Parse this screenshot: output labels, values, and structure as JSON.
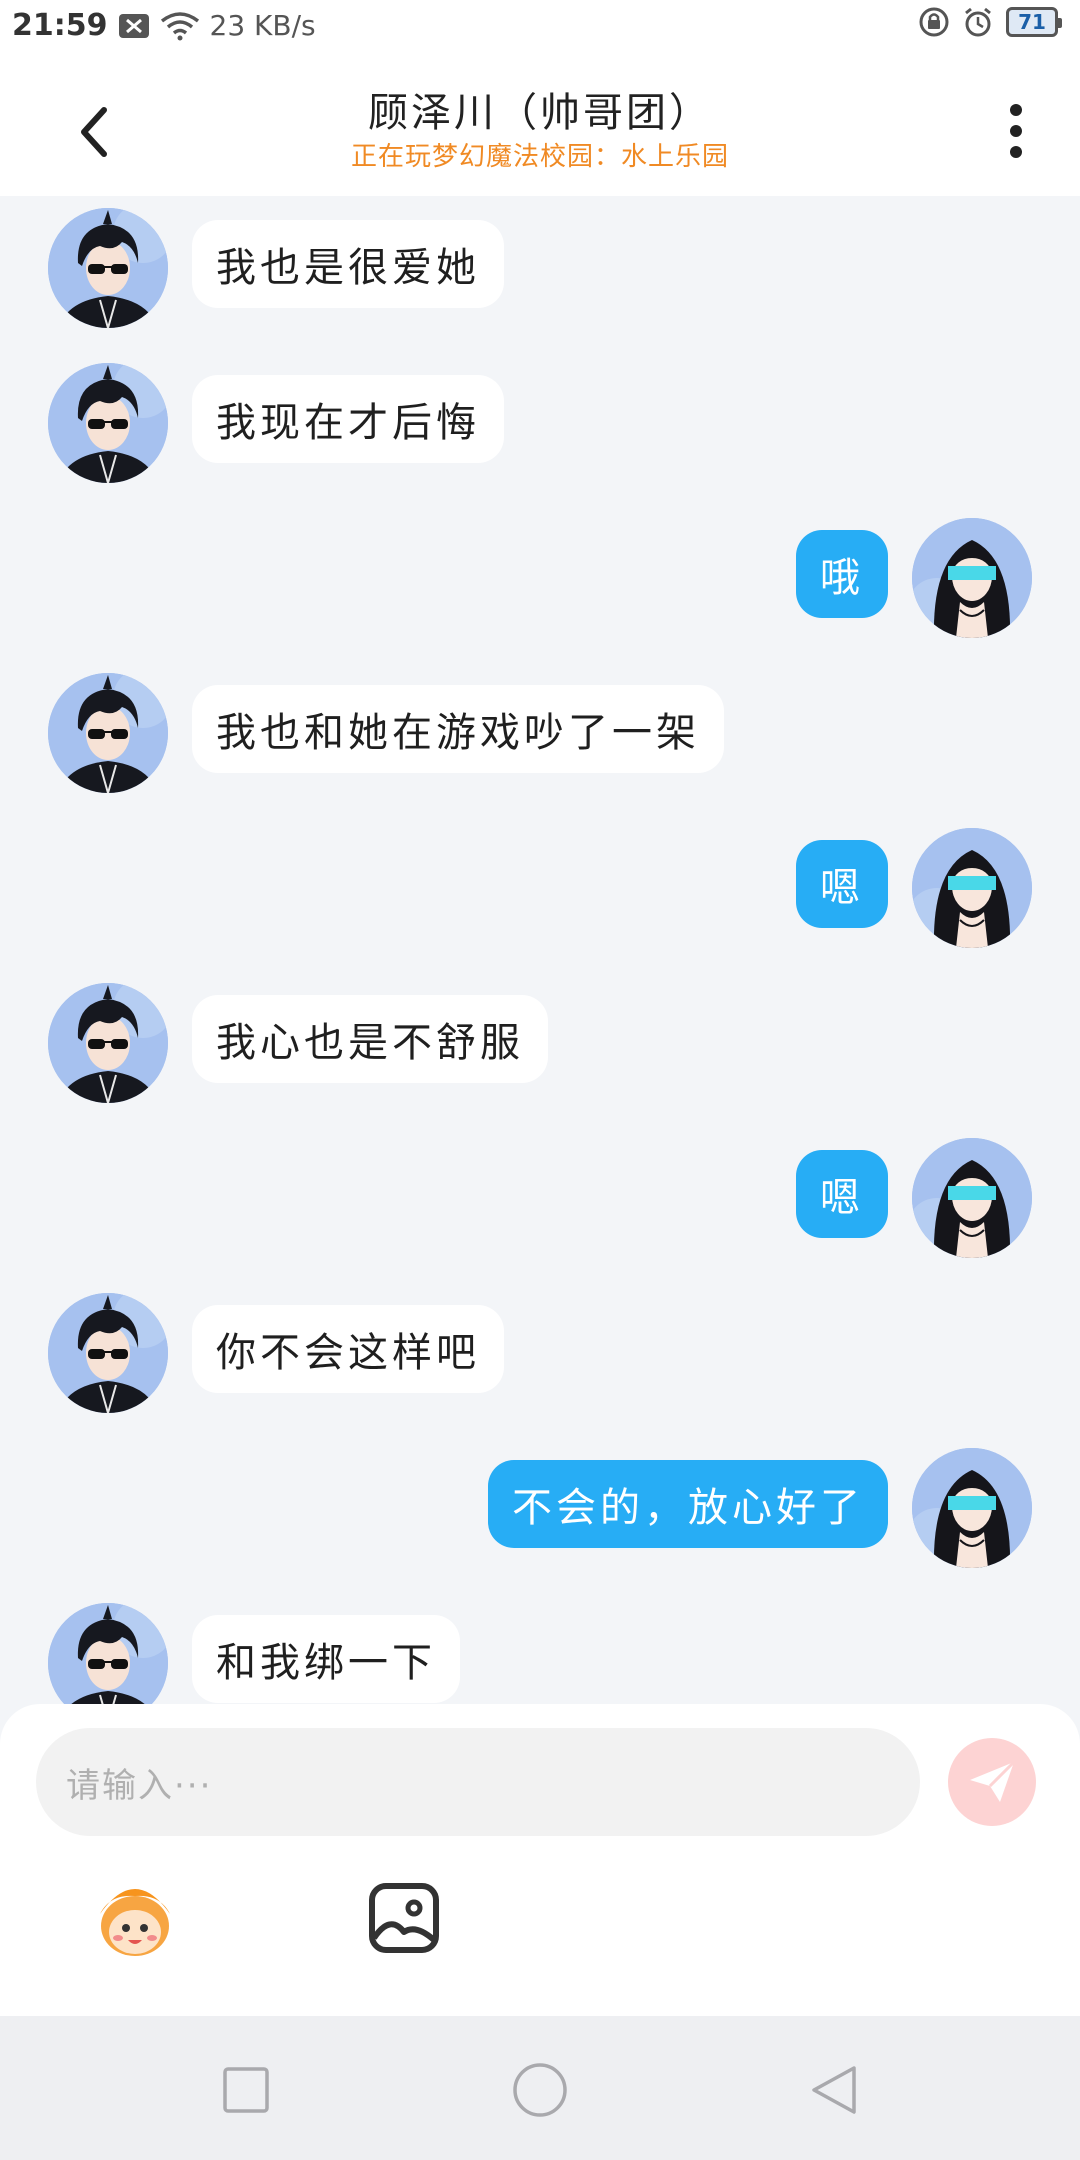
{
  "status_bar": {
    "time": "21:59",
    "net_speed": "23 KB/s",
    "battery": "71"
  },
  "header": {
    "title": "顾泽川（帅哥团）",
    "subtitle": "正在玩梦幻魔法校园：水上乐园"
  },
  "messages": [
    {
      "side": "in",
      "text": "我也是很爱她"
    },
    {
      "side": "in",
      "text": "我现在才后悔"
    },
    {
      "side": "out",
      "text": "哦"
    },
    {
      "side": "in",
      "text": "我也和她在游戏吵了一架"
    },
    {
      "side": "out",
      "text": "嗯"
    },
    {
      "side": "in",
      "text": "我心也是不舒服"
    },
    {
      "side": "out",
      "text": "嗯"
    },
    {
      "side": "in",
      "text": "你不会这样吧"
    },
    {
      "side": "out",
      "text": "不会的，放心好了"
    },
    {
      "side": "in",
      "text": "和我绑一下"
    }
  ],
  "composer": {
    "placeholder": "请输入···"
  },
  "colors": {
    "outgoing_bubble": "#27adf5",
    "incoming_bubble": "#ffffff",
    "subtitle": "#f08a24",
    "send_button": "#fdd3d3"
  },
  "icons": [
    "back-arrow-icon",
    "more-vertical-icon",
    "send-icon",
    "emoji-mascot-icon",
    "image-icon",
    "nav-recents-icon",
    "nav-home-icon",
    "nav-back-icon"
  ]
}
